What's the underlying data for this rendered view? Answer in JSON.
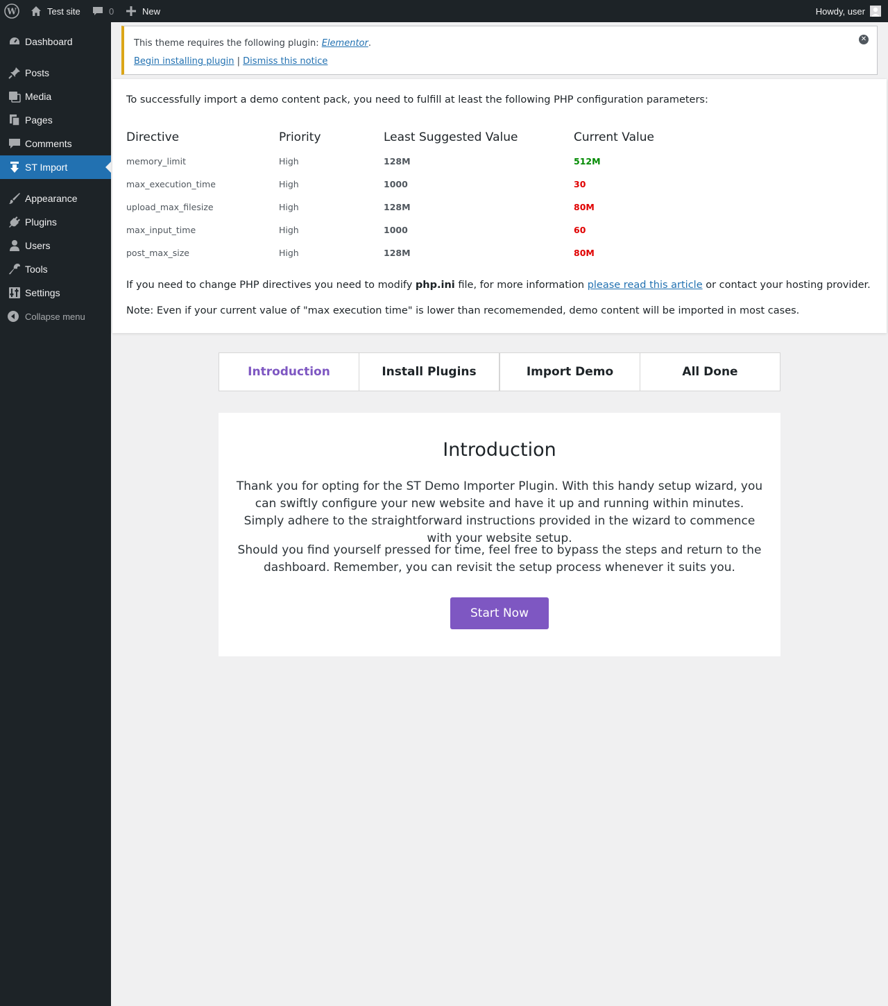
{
  "adminbar": {
    "site_name": "Test site",
    "comments_count": "0",
    "new_label": "New",
    "howdy": "Howdy, user"
  },
  "sidebar": {
    "items": [
      {
        "label": "Dashboard",
        "icon": "dashboard-icon"
      },
      {
        "label": "Posts",
        "icon": "pin-icon"
      },
      {
        "label": "Media",
        "icon": "media-icon"
      },
      {
        "label": "Pages",
        "icon": "pages-icon"
      },
      {
        "label": "Comments",
        "icon": "comment-icon"
      },
      {
        "label": "ST Import",
        "icon": "import-icon",
        "current": true
      },
      {
        "label": "Appearance",
        "icon": "brush-icon"
      },
      {
        "label": "Plugins",
        "icon": "plug-icon"
      },
      {
        "label": "Users",
        "icon": "user-icon"
      },
      {
        "label": "Tools",
        "icon": "wrench-icon"
      },
      {
        "label": "Settings",
        "icon": "settings-icon"
      }
    ],
    "collapse_label": "Collapse menu"
  },
  "notice": {
    "text_before": "This theme requires the following plugin: ",
    "plugin_name": "Elementor",
    "text_after": ".",
    "install_link": "Begin installing plugin",
    "separator": " | ",
    "dismiss_link": "Dismiss this notice"
  },
  "requirements": {
    "intro": "To successfully import a demo content pack, you need to fulfill at least the following PHP configuration parameters:",
    "headers": [
      "Directive",
      "Priority",
      "Least Suggested Value",
      "Current Value"
    ],
    "rows": [
      {
        "directive": "memory_limit",
        "priority": "High",
        "suggested": "128M",
        "current": "512M",
        "status": "ok"
      },
      {
        "directive": "max_execution_time",
        "priority": "High",
        "suggested": "1000",
        "current": "30",
        "status": "bad"
      },
      {
        "directive": "upload_max_filesize",
        "priority": "High",
        "suggested": "128M",
        "current": "80M",
        "status": "bad"
      },
      {
        "directive": "max_input_time",
        "priority": "High",
        "suggested": "1000",
        "current": "60",
        "status": "bad"
      },
      {
        "directive": "post_max_size",
        "priority": "High",
        "suggested": "128M",
        "current": "80M",
        "status": "bad"
      }
    ],
    "note1_before": "If you need to change PHP directives you need to modify ",
    "note1_file": "php.ini",
    "note1_middle": " file, for more information ",
    "note1_link": "please read this article",
    "note1_after": " or contact your hosting provider.",
    "note2": "Note: Even if your current value of \"max execution time\" is lower than recomemended, demo content will be imported in most cases."
  },
  "tabs": [
    {
      "label": "Introduction",
      "active": true
    },
    {
      "label": "Install Plugins"
    },
    {
      "label": "Import Demo"
    },
    {
      "label": "All Done"
    }
  ],
  "intro_card": {
    "title": "Introduction",
    "paragraph1": "Thank you for opting for the ST Demo Importer Plugin. With this handy setup wizard, you can swiftly configure your new website and have it up and running within minutes. Simply adhere to the straightforward instructions provided in the wizard to commence with your website setup.",
    "paragraph2": "Should you find yourself pressed for time, feel free to bypass the steps and return to the dashboard. Remember, you can revisit the setup process whenever it suits you.",
    "button": "Start Now"
  },
  "colors": {
    "accent": "#7e57c2",
    "wp_blue": "#2271b1",
    "ok": "#008a00",
    "bad": "#e00000",
    "notice_border": "#dba617"
  }
}
